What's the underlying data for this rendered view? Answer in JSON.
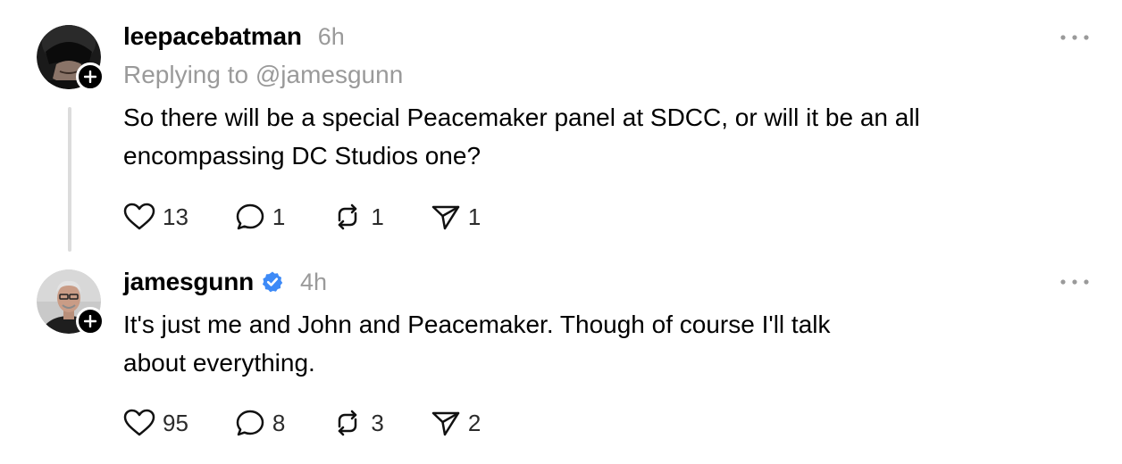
{
  "posts": [
    {
      "username": "leepacebatman",
      "verified": false,
      "time": "6h",
      "reply_to": "Replying to @jamesgunn",
      "text_lines": [
        "So there will be a special Peacemaker panel at SDCC, or will it be an all",
        "encompassing DC Studios one?"
      ],
      "likes": "13",
      "replies": "1",
      "reposts": "1",
      "shares": "1"
    },
    {
      "username": "jamesgunn",
      "verified": true,
      "time": "4h",
      "text_lines": [
        "It's just me and John and Peacemaker. Though of course I'll talk",
        "about everything."
      ],
      "likes": "95",
      "replies": "8",
      "reposts": "3",
      "shares": "2"
    }
  ],
  "icons": {
    "like": "heart-icon",
    "reply": "comment-bubble-icon",
    "repost": "repost-icon",
    "share": "send-icon",
    "more": "more-dots-icon",
    "follow": "plus-icon",
    "verified": "verified-badge-icon"
  },
  "colors": {
    "verified": "#3d8af7",
    "muted": "#9a9a9a",
    "thread_line": "#dcdcdc"
  }
}
